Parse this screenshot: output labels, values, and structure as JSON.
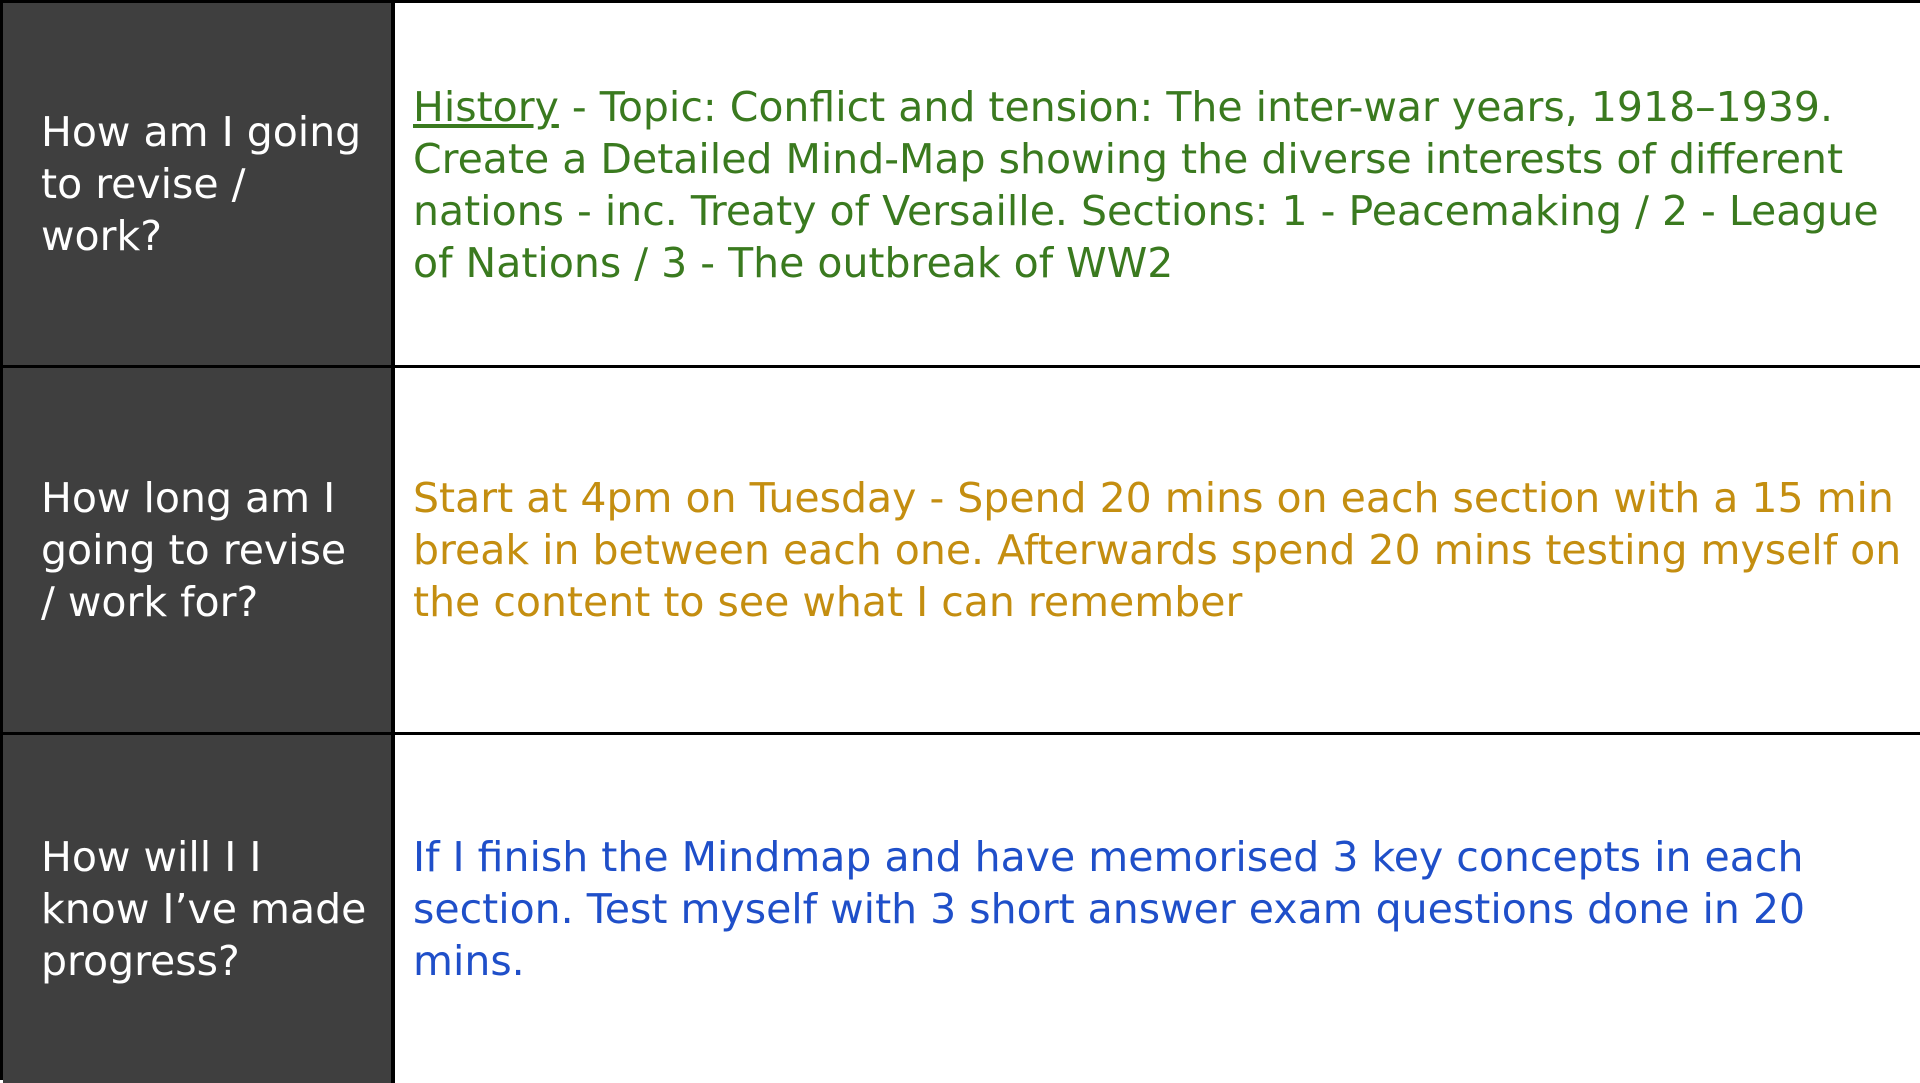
{
  "rows": [
    {
      "label": "How am I going to revise / work?",
      "content_subject": "History",
      "content_rest": " - Topic: Conflict and tension: The inter-war years, 1918–1939. Create a Detailed Mind-Map showing the diverse interests of different nations - inc. Treaty of Versaille. Sections: 1 - Peacemaking / 2 - League of Nations / 3 - The outbreak of WW2",
      "color": "#3a7a1f"
    },
    {
      "label": "How long am I going to revise / work for?",
      "content": "Start at 4pm on Tuesday - Spend 20 mins on each section with a 15 min break in between each one.  Afterwards spend 20 mins testing myself on the content to see what I can remember",
      "color": "#c48e10"
    },
    {
      "label": "How will I I know I’ve made progress?",
      "content": "If I finish the Mindmap and have memorised 3 key concepts in each section. Test myself with 3 short answer exam questions done in 20 mins.",
      "color": "#1f4fc9"
    }
  ],
  "colors": {
    "label_background": "#3f3f3f",
    "label_text": "#ffffff",
    "border": "#000000"
  }
}
